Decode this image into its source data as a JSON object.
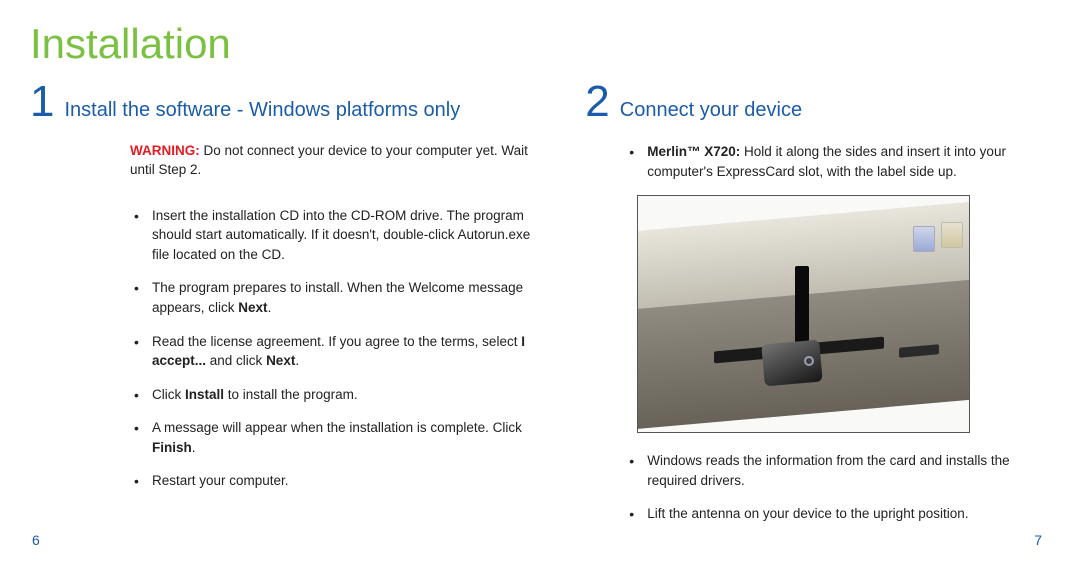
{
  "title": "Installation",
  "left": {
    "step_number": "1",
    "step_title": "Install the software - Windows platforms only",
    "warning_label": "WARNING:",
    "warning_text": " Do not connect your device to your computer yet. Wait until Step 2.",
    "bullets": [
      {
        "pre": "Insert the installation CD into the CD-ROM drive. The program should start automatically. If it doesn't, double-click Autorun.exe file located on the CD."
      },
      {
        "pre": "The program prepares to install. When the Welcome message appears, click ",
        "b1": "Next",
        "post1": "."
      },
      {
        "pre": "Read the license agreement. If you agree to the terms, select ",
        "b1": "I accept...",
        "mid1": " and click ",
        "b2": "Next",
        "post2": "."
      },
      {
        "pre": "Click ",
        "b1": "Install",
        "post1": " to install the program."
      },
      {
        "pre": "A message will appear when the installation is complete. Click ",
        "b1": "Finish",
        "post1": "."
      },
      {
        "pre": "Restart your computer."
      }
    ]
  },
  "right": {
    "step_number": "2",
    "step_title": "Connect your device",
    "top_bullet_bold": "Merlin™ X720:",
    "top_bullet_text": " Hold it along the sides and insert it into your computer's ExpressCard slot, with the label side up.",
    "bullets_below": [
      "Windows reads the information from the card and installs the required drivers.",
      "Lift the antenna on your device to the upright position."
    ]
  },
  "page_left": "6",
  "page_right": "7"
}
